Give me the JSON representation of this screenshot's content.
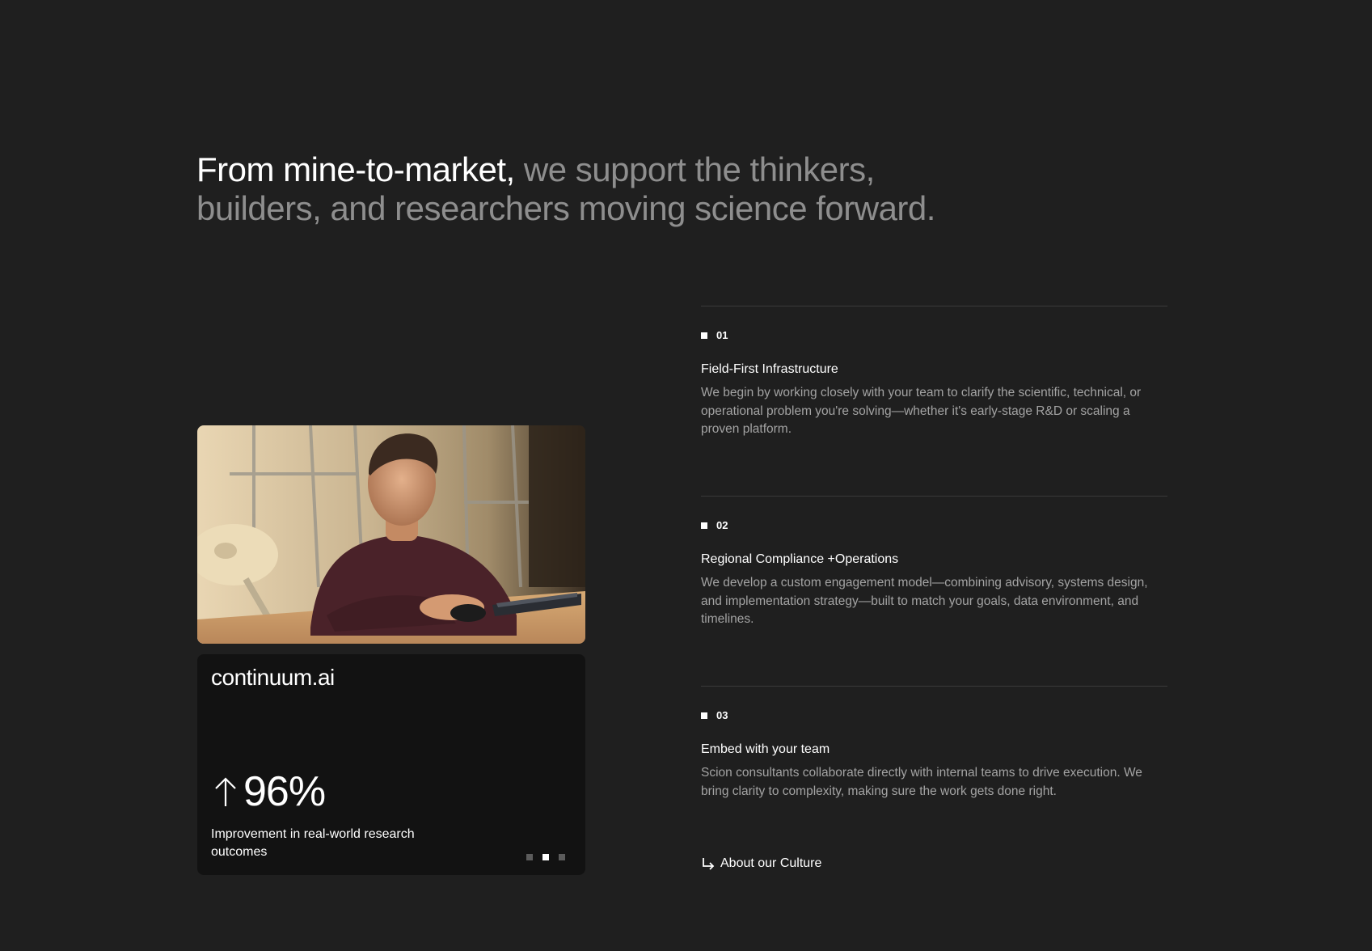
{
  "headline": {
    "strong": "From mine-to-market,",
    "muted": " we support the thinkers, builders, and researchers moving science forward."
  },
  "card": {
    "brand": "continuum.ai",
    "stat_arrow_icon": "arrow-up-icon",
    "stat_value": "96%",
    "stat_caption": "Improvement in real-world research outcomes",
    "carousel": {
      "count": 3,
      "active": 2
    }
  },
  "steps": [
    {
      "number": "01",
      "title": "Field-First Infrastructure",
      "body": "We begin by working closely with your team to clarify the scientific, technical, or operational problem you're solving—whether it's early-stage R&D or scaling a proven platform."
    },
    {
      "number": "02",
      "title": "Regional Compliance +Operations",
      "body": "We develop a custom engagement model—combining advisory, systems design, and implementation strategy—built to match your goals, data environment, and timelines."
    },
    {
      "number": "03",
      "title": "Embed with your team",
      "body": "Scion consultants collaborate directly with internal teams to drive execution. We bring clarity to complexity, making sure the work gets done right."
    }
  ],
  "culture_link": {
    "icon": "arrow-down-right-icon",
    "label": "About our Culture"
  },
  "colors": {
    "background": "#1f1f1f",
    "card": "#121212",
    "muted_text": "#8e8e8e",
    "body_text": "#a3a3a3"
  }
}
